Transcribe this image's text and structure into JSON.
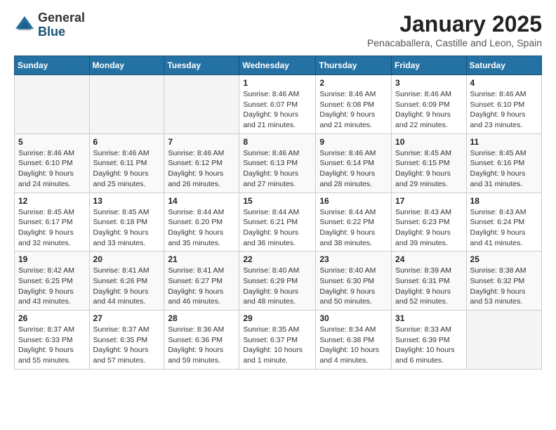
{
  "logo": {
    "general": "General",
    "blue": "Blue"
  },
  "header": {
    "title": "January 2025",
    "location": "Penacaballera, Castille and Leon, Spain"
  },
  "weekdays": [
    "Sunday",
    "Monday",
    "Tuesday",
    "Wednesday",
    "Thursday",
    "Friday",
    "Saturday"
  ],
  "weeks": [
    [
      {
        "day": "",
        "info": ""
      },
      {
        "day": "",
        "info": ""
      },
      {
        "day": "",
        "info": ""
      },
      {
        "day": "1",
        "info": "Sunrise: 8:46 AM\nSunset: 6:07 PM\nDaylight: 9 hours and 21 minutes."
      },
      {
        "day": "2",
        "info": "Sunrise: 8:46 AM\nSunset: 6:08 PM\nDaylight: 9 hours and 21 minutes."
      },
      {
        "day": "3",
        "info": "Sunrise: 8:46 AM\nSunset: 6:09 PM\nDaylight: 9 hours and 22 minutes."
      },
      {
        "day": "4",
        "info": "Sunrise: 8:46 AM\nSunset: 6:10 PM\nDaylight: 9 hours and 23 minutes."
      }
    ],
    [
      {
        "day": "5",
        "info": "Sunrise: 8:46 AM\nSunset: 6:10 PM\nDaylight: 9 hours and 24 minutes."
      },
      {
        "day": "6",
        "info": "Sunrise: 8:46 AM\nSunset: 6:11 PM\nDaylight: 9 hours and 25 minutes."
      },
      {
        "day": "7",
        "info": "Sunrise: 8:46 AM\nSunset: 6:12 PM\nDaylight: 9 hours and 26 minutes."
      },
      {
        "day": "8",
        "info": "Sunrise: 8:46 AM\nSunset: 6:13 PM\nDaylight: 9 hours and 27 minutes."
      },
      {
        "day": "9",
        "info": "Sunrise: 8:46 AM\nSunset: 6:14 PM\nDaylight: 9 hours and 28 minutes."
      },
      {
        "day": "10",
        "info": "Sunrise: 8:45 AM\nSunset: 6:15 PM\nDaylight: 9 hours and 29 minutes."
      },
      {
        "day": "11",
        "info": "Sunrise: 8:45 AM\nSunset: 6:16 PM\nDaylight: 9 hours and 31 minutes."
      }
    ],
    [
      {
        "day": "12",
        "info": "Sunrise: 8:45 AM\nSunset: 6:17 PM\nDaylight: 9 hours and 32 minutes."
      },
      {
        "day": "13",
        "info": "Sunrise: 8:45 AM\nSunset: 6:18 PM\nDaylight: 9 hours and 33 minutes."
      },
      {
        "day": "14",
        "info": "Sunrise: 8:44 AM\nSunset: 6:20 PM\nDaylight: 9 hours and 35 minutes."
      },
      {
        "day": "15",
        "info": "Sunrise: 8:44 AM\nSunset: 6:21 PM\nDaylight: 9 hours and 36 minutes."
      },
      {
        "day": "16",
        "info": "Sunrise: 8:44 AM\nSunset: 6:22 PM\nDaylight: 9 hours and 38 minutes."
      },
      {
        "day": "17",
        "info": "Sunrise: 8:43 AM\nSunset: 6:23 PM\nDaylight: 9 hours and 39 minutes."
      },
      {
        "day": "18",
        "info": "Sunrise: 8:43 AM\nSunset: 6:24 PM\nDaylight: 9 hours and 41 minutes."
      }
    ],
    [
      {
        "day": "19",
        "info": "Sunrise: 8:42 AM\nSunset: 6:25 PM\nDaylight: 9 hours and 43 minutes."
      },
      {
        "day": "20",
        "info": "Sunrise: 8:41 AM\nSunset: 6:26 PM\nDaylight: 9 hours and 44 minutes."
      },
      {
        "day": "21",
        "info": "Sunrise: 8:41 AM\nSunset: 6:27 PM\nDaylight: 9 hours and 46 minutes."
      },
      {
        "day": "22",
        "info": "Sunrise: 8:40 AM\nSunset: 6:29 PM\nDaylight: 9 hours and 48 minutes."
      },
      {
        "day": "23",
        "info": "Sunrise: 8:40 AM\nSunset: 6:30 PM\nDaylight: 9 hours and 50 minutes."
      },
      {
        "day": "24",
        "info": "Sunrise: 8:39 AM\nSunset: 6:31 PM\nDaylight: 9 hours and 52 minutes."
      },
      {
        "day": "25",
        "info": "Sunrise: 8:38 AM\nSunset: 6:32 PM\nDaylight: 9 hours and 53 minutes."
      }
    ],
    [
      {
        "day": "26",
        "info": "Sunrise: 8:37 AM\nSunset: 6:33 PM\nDaylight: 9 hours and 55 minutes."
      },
      {
        "day": "27",
        "info": "Sunrise: 8:37 AM\nSunset: 6:35 PM\nDaylight: 9 hours and 57 minutes."
      },
      {
        "day": "28",
        "info": "Sunrise: 8:36 AM\nSunset: 6:36 PM\nDaylight: 9 hours and 59 minutes."
      },
      {
        "day": "29",
        "info": "Sunrise: 8:35 AM\nSunset: 6:37 PM\nDaylight: 10 hours and 1 minute."
      },
      {
        "day": "30",
        "info": "Sunrise: 8:34 AM\nSunset: 6:38 PM\nDaylight: 10 hours and 4 minutes."
      },
      {
        "day": "31",
        "info": "Sunrise: 8:33 AM\nSunset: 6:39 PM\nDaylight: 10 hours and 6 minutes."
      },
      {
        "day": "",
        "info": ""
      }
    ]
  ]
}
